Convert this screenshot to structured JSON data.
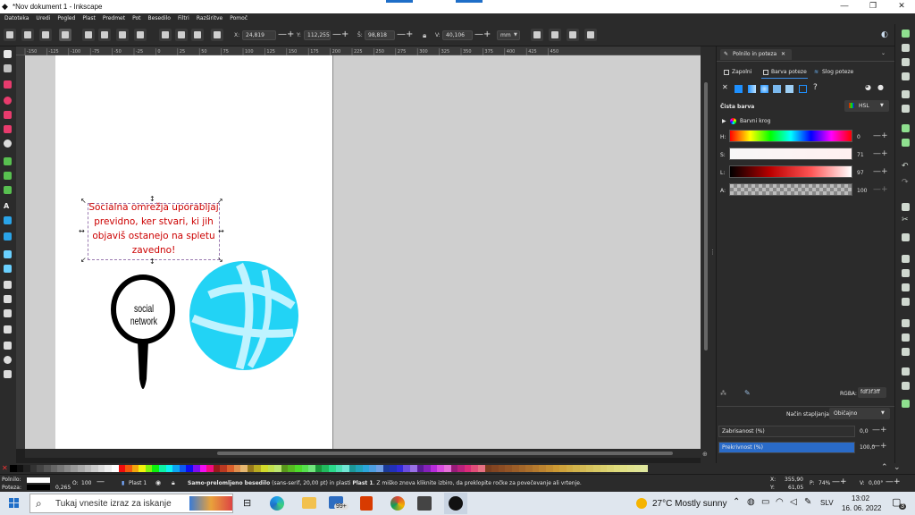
{
  "window": {
    "title": "*Nov dokument 1 - Inkscape"
  },
  "menu": [
    "Datoteka",
    "Uredi",
    "Pogled",
    "Plast",
    "Predmet",
    "Pot",
    "Besedilo",
    "Filtri",
    "Razširitve",
    "Pomoč"
  ],
  "toolbar": {
    "x_label": "X:",
    "x_value": "24,819",
    "y_label": "Y:",
    "y_value": "112,255",
    "w_label": "Š:",
    "w_value": "98,818",
    "h_label": "V:",
    "h_value": "40,106",
    "unit": "mm"
  },
  "canvas_text": {
    "paragraph": [
      "Socialna omrežja uporabljaj",
      "previdno, ker stvari, ki jih",
      "objaviš ostanejo na spletu",
      "zavedno!"
    ],
    "pin_label": "social network",
    "text_color": "#cc0000"
  },
  "ruler_labels": [
    "-150",
    "-125",
    "-100",
    "-75",
    "-50",
    "-25",
    "0",
    "25",
    "50",
    "75",
    "100",
    "125",
    "150",
    "175",
    "200",
    "225",
    "250",
    "275",
    "300",
    "325",
    "350",
    "375",
    "400",
    "425",
    "450"
  ],
  "panel": {
    "tab_title": "Polnilo in poteza",
    "subtabs": [
      "Zapolni",
      "Barva poteze",
      "Slog poteze"
    ],
    "flat_color_label": "Čista barva",
    "mode": "HSL",
    "wheel_label": "Barvni krog",
    "sliders": [
      {
        "label": "H:",
        "value": "0"
      },
      {
        "label": "S:",
        "value": "71"
      },
      {
        "label": "L:",
        "value": "97"
      },
      {
        "label": "A:",
        "value": "100"
      }
    ],
    "rgba_label": "RGBA:",
    "rgba_value": "fdf3f3ff",
    "blend_label": "Način stapljanja:",
    "blend_value": "Običajno",
    "blur_label": "Zabrisanost (%)",
    "blur_value": "0,0",
    "opacity_label": "Prekrivnost (%)",
    "opacity_value": "100,0",
    "opacity_level": 1.0
  },
  "status": {
    "fill_label": "Polnilo:",
    "stroke_label": "Poteza:",
    "stroke_width": "0,265",
    "o_label": "O:",
    "o_value": "100",
    "layer": "Plast 1",
    "message_bold": "Samo-prelomljeno besedilo",
    "message": " (sans-serif, 20,00 pt) in plasti ",
    "message_layer": "Plast 1",
    "message_tail": ". Z miško znova kliknite izbiro, da preklopite ročke za povečevanje ali vrtenje.",
    "x_label": "X:",
    "x_value": "355,90",
    "y_label": "Y:",
    "y_value": "61,05",
    "zoom_label": "P:",
    "zoom_value": "74%",
    "rot_label": "V:",
    "rot_value": "0,00°"
  },
  "taskbar": {
    "search_placeholder": "Tukaj vnesite izraz za iskanje",
    "weather": "27°C  Mostly sunny",
    "language": "SLV",
    "time": "13:02",
    "date": "16. 06. 2022",
    "badge": "99+",
    "notif_count": "3"
  },
  "colors": {
    "accent": "#1e6ec8",
    "globe": "#22d3f5",
    "globe_lines": "#bff3ff",
    "opacity_bar": "#2a6bc8"
  }
}
